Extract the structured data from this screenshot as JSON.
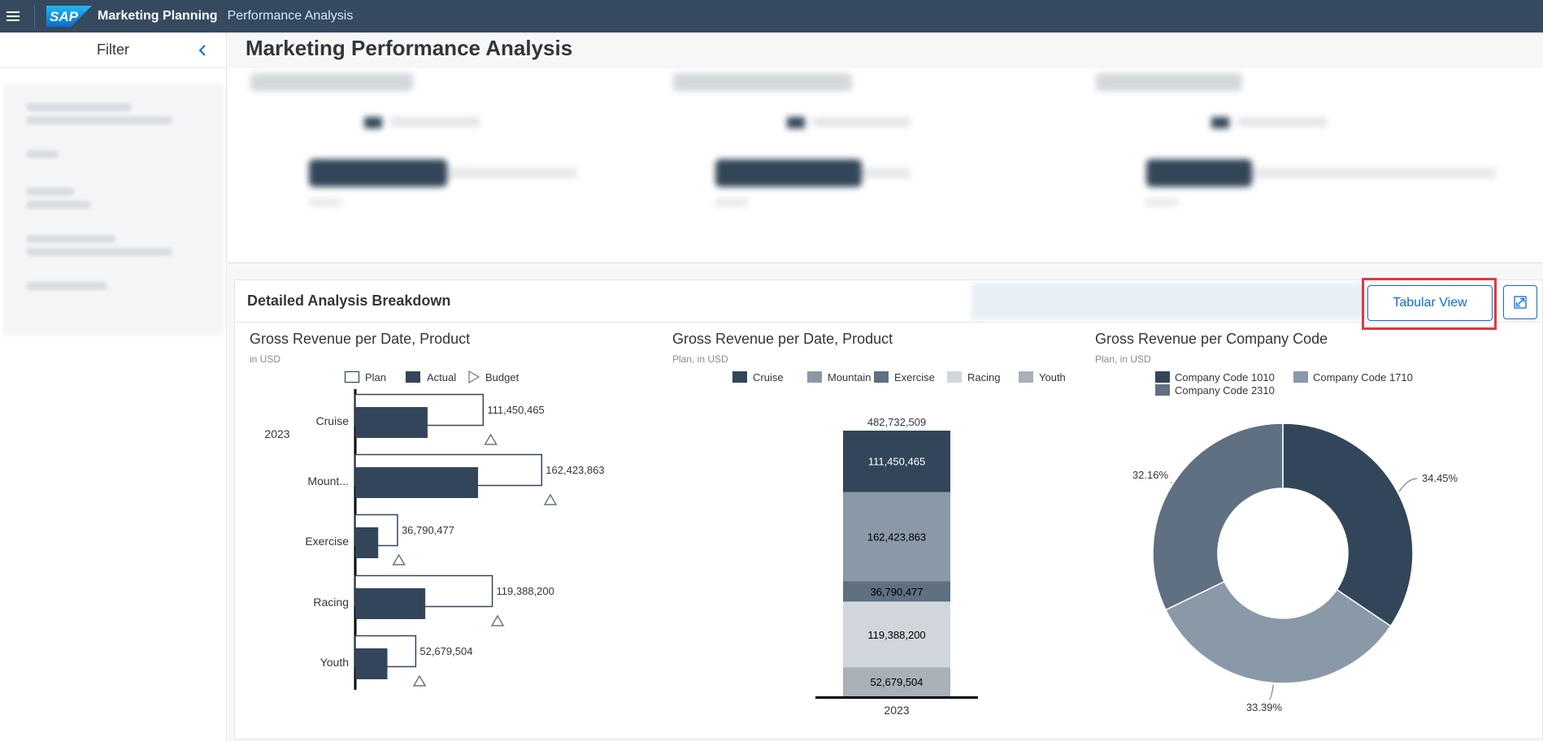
{
  "shell": {
    "logo_text": "SAP",
    "app_title": "Marketing Planning",
    "sub_title": "Performance Analysis",
    "menu_icon": "hamburger-icon"
  },
  "sidebar": {
    "title": "Filter",
    "collapse_icon": "chevron-left-icon"
  },
  "page": {
    "title": "Marketing Performance Analysis"
  },
  "panel": {
    "title": "Detailed Analysis Breakdown",
    "tabular_view_label": "Tabular View",
    "fullscreen_icon": "fullscreen-icon"
  },
  "colors": {
    "shell": "#354a5f",
    "accent": "#0a6ed1",
    "highlight": "#e0393e",
    "cruise": "#334659",
    "mountain": "#8a99a8",
    "exercise": "#5e7081",
    "racing": "#d1d6dd",
    "youth": "#a8b0b8"
  },
  "chart_data": [
    {
      "type": "bar",
      "title": "Gross Revenue per Date, Product",
      "subtitle": "in USD",
      "legend": [
        "Plan",
        "Actual",
        "Budget"
      ],
      "group_label": "2023",
      "categories": [
        "Cruise",
        "Mount...",
        "Exercise",
        "Racing",
        "Youth"
      ],
      "series": [
        {
          "name": "Plan",
          "values": [
            111450465,
            162423863,
            36790477,
            119388200,
            52679504
          ]
        },
        {
          "name": "Actual",
          "values": [
            63000000,
            107000000,
            20000000,
            61000000,
            28000000
          ]
        },
        {
          "name": "Budget",
          "values": [
            118000000,
            170000000,
            38000000,
            124000000,
            56000000
          ]
        }
      ],
      "data_labels": [
        "111,450,465",
        "162,423,863",
        "36,790,477",
        "119,388,200",
        "52,679,504"
      ]
    },
    {
      "type": "bar",
      "stacked": true,
      "title": "Gross Revenue per Date, Product",
      "subtitle": "Plan, in USD",
      "legend": [
        "Cruise",
        "Mountain",
        "Exercise",
        "Racing",
        "Youth"
      ],
      "categories": [
        "2023"
      ],
      "total_label": "482,732,509",
      "series": [
        {
          "name": "Cruise",
          "values": [
            111450465
          ],
          "label": "111,450,465"
        },
        {
          "name": "Mountain",
          "values": [
            162423863
          ],
          "label": "162,423,863"
        },
        {
          "name": "Exercise",
          "values": [
            36790477
          ],
          "label": "36,790,477"
        },
        {
          "name": "Racing",
          "values": [
            119388200
          ],
          "label": "119,388,200"
        },
        {
          "name": "Youth",
          "values": [
            52679504
          ],
          "label": "52,679,504"
        }
      ]
    },
    {
      "type": "pie",
      "donut": true,
      "title": "Gross Revenue per Company Code",
      "subtitle": "Plan, in USD",
      "legend": [
        "Company Code 1010",
        "Company Code 1710",
        "Company Code 2310"
      ],
      "slices": [
        {
          "name": "Company Code 1010",
          "value": 34.45,
          "label": "34.45%"
        },
        {
          "name": "Company Code 1710",
          "value": 33.39,
          "label": "33.39%"
        },
        {
          "name": "Company Code 2310",
          "value": 32.16,
          "label": "32.16%"
        }
      ]
    }
  ]
}
